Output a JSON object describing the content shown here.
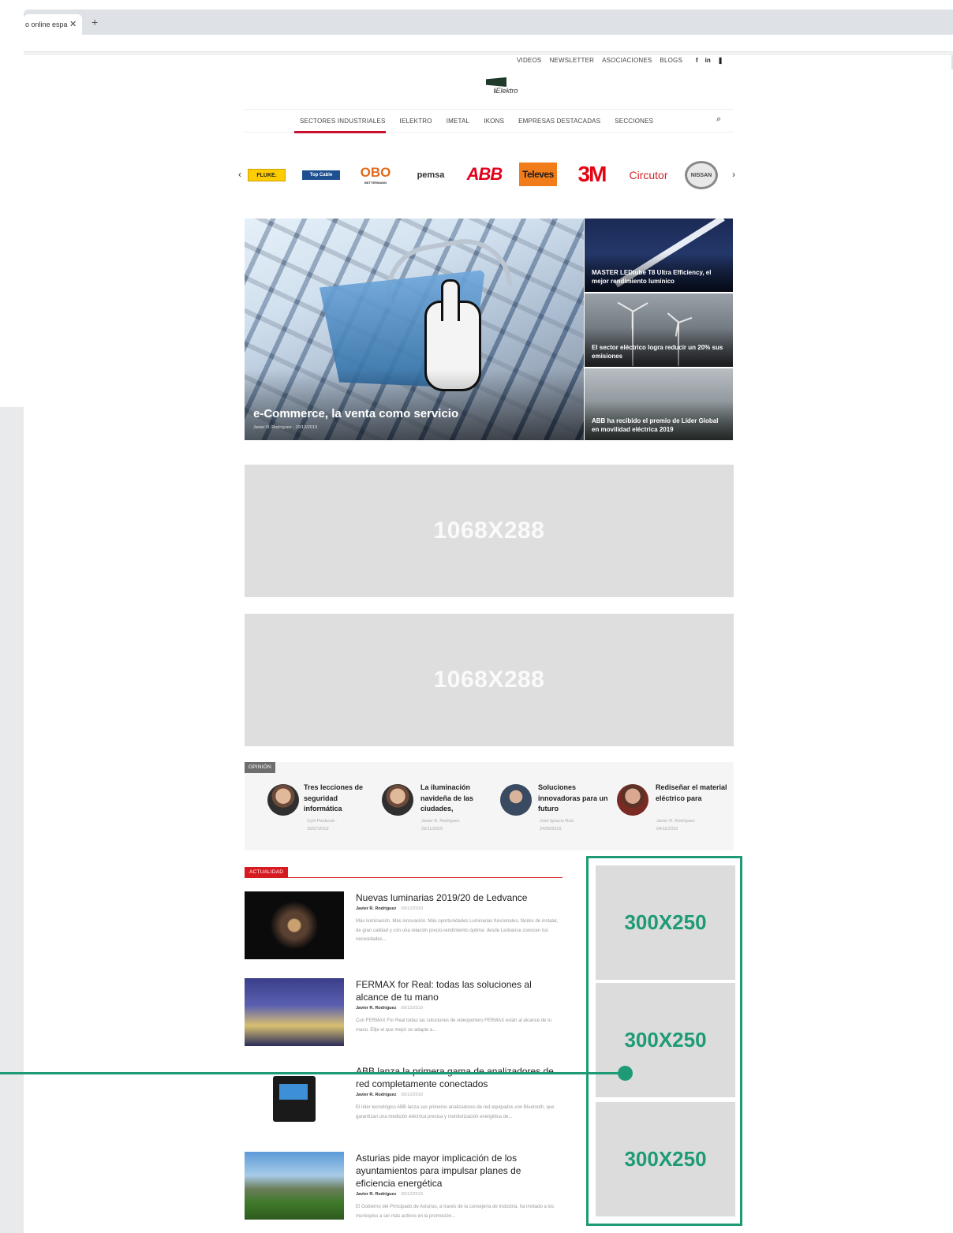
{
  "browser": {
    "tab_title": "o online espa",
    "close_glyph": "✕",
    "new_tab_glyph": "+"
  },
  "top_links": [
    "VIDEOS",
    "NEWSLETTER",
    "ASOCIACIONES",
    "BLOGS"
  ],
  "social": [
    "f",
    "in",
    "❚"
  ],
  "logo": {
    "prefix": "i",
    "name": "Elektro"
  },
  "nav": {
    "items": [
      "SECTORES INDUSTRIALES",
      "IELEKTRO",
      "IMETAL",
      "IKONS",
      "EMPRESAS DESTACADAS",
      "SECCIONES"
    ],
    "active_index": 0,
    "search_glyph": "⌕"
  },
  "brands": {
    "prev": "‹",
    "next": "›",
    "items": [
      "FLUKE.",
      "Top Cable",
      "OBO",
      "BETTERMANN",
      "pemsa",
      "ABB",
      "Televes",
      "3M",
      "Circutor",
      "NISSAN"
    ]
  },
  "hero": {
    "title": "e-Commerce, la venta como servicio",
    "meta": "Javier R. Rodríguez - 10/12/2019"
  },
  "side_cards": [
    {
      "title": "MASTER LEDtube T8 Ultra Efficiency, el mejor rendimiento lumínico"
    },
    {
      "title": "El sector eléctrico logra reducir un 20% sus emisiones"
    },
    {
      "title": "ABB ha recibido el premio de Líder Global en movilidad eléctrica 2019"
    }
  ],
  "ads": {
    "wide_1": "1068X288",
    "wide_2": "1068X288",
    "box_1": "300X250",
    "box_2": "300X250",
    "box_3": "300X250"
  },
  "opinion": {
    "tag": "OPINIÓN",
    "items": [
      {
        "title": "Tres lecciones de seguridad informática",
        "author": "Cyril Perducat -",
        "date": "16/07/2019"
      },
      {
        "title": "La iluminación navideña de las ciudades,",
        "author": "Javier R. Rodríguez",
        "date": "29/11/2019"
      },
      {
        "title": "Soluciones innovadoras para un futuro",
        "author": "José Ignacio Ruiz",
        "date": "24/09/2019"
      },
      {
        "title": "Rediseñar el material eléctrico para",
        "author": "Javier R. Rodríguez",
        "date": "04/11/2019"
      }
    ]
  },
  "actualidad": {
    "tag": "ACTUALIDAD",
    "items": [
      {
        "title": "Nuevas luminarias 2019/20 de Ledvance",
        "author": "Javier R. Rodríguez",
        "date": "09/12/2019",
        "desc": "Más iluminación. Más innovación. Más oportunidades Luminarias funcionales, fáciles de instalar, de gran calidad y con una relación precio-rendimiento óptima: desde Ledvance conocen tus necesidades..."
      },
      {
        "title": "FERMAX for Real: todas las soluciones al alcance de tu mano",
        "author": "Javier R. Rodríguez",
        "date": "09/12/2019",
        "desc": "Con FERMAX For Real todas las soluciones de videoportero FERMAX están al alcance de tu mano. Elije el que mejor se adapte a..."
      },
      {
        "title": "ABB lanza la primera gama de analizadores de red completamente conectados",
        "author": "Javier R. Rodríguez",
        "date": "05/12/2019",
        "desc": "El líder tecnológico ABB lanza sus primeros analizadores de red equipados con Bluetooth, que garantizan una medición eléctrica precisa y monitorización energética de..."
      },
      {
        "title": "Asturias pide mayor implicación de los ayuntamientos para impulsar planes de eficiencia energética",
        "author": "Javier R. Rodríguez",
        "date": "05/12/2019",
        "desc": "El Gobierno del Principado de Asturias, a través de la consejería de Industria, ha invitado a los municipios a ser más activos en la promoción..."
      }
    ]
  },
  "colors": {
    "accent_red": "#c8102e",
    "highlight_green": "#1e9b76",
    "ad_gray": "#dedede"
  }
}
